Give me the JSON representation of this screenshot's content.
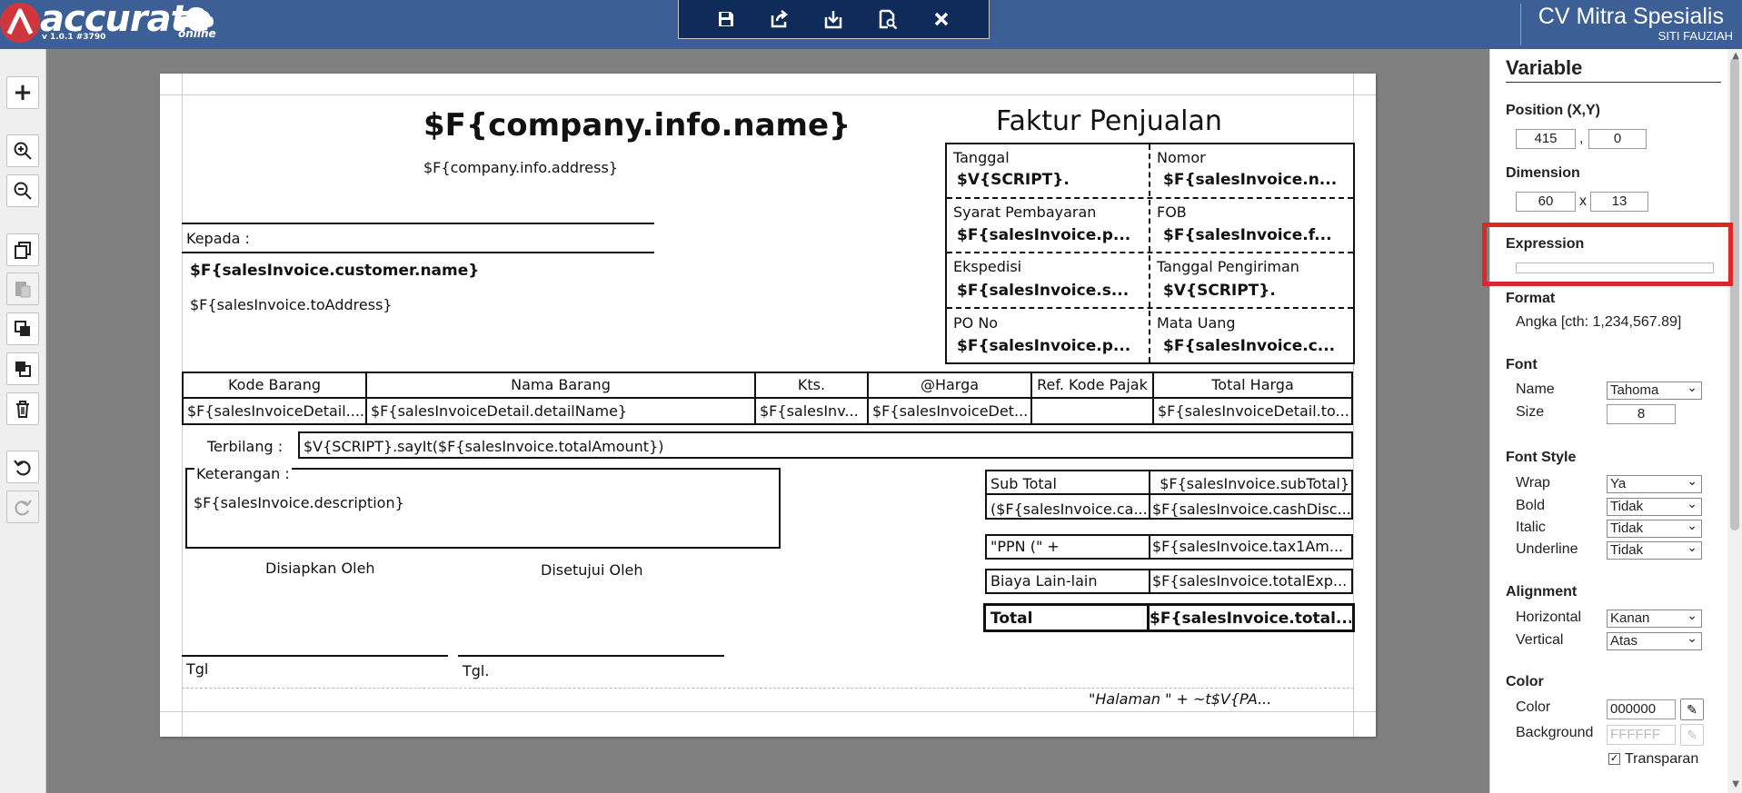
{
  "header": {
    "logo_text": "accurate",
    "logo_version": "v 1.0.1 #3790",
    "logo_online": "online",
    "company": "CV Mitra Spesialis",
    "user": "SITI FAUZIAH",
    "toolbar": [
      {
        "icon": "save-icon",
        "glyph": "🖫"
      },
      {
        "icon": "export-icon",
        "glyph": "⇪"
      },
      {
        "icon": "import-icon",
        "glyph": "⇩"
      },
      {
        "icon": "preview-icon",
        "glyph": "🔍"
      },
      {
        "icon": "close-icon",
        "glyph": "✕"
      }
    ]
  },
  "tools": [
    {
      "name": "add-tool-button",
      "glyph": "+",
      "enabled": true
    },
    {
      "name": "zoom-in-button",
      "glyph": "⊕",
      "enabled": true
    },
    {
      "name": "zoom-out-button",
      "glyph": "⊖",
      "enabled": true
    },
    {
      "name": "copy-button",
      "glyph": "❐",
      "enabled": true
    },
    {
      "name": "paste-button",
      "glyph": "▤",
      "enabled": false
    },
    {
      "name": "bring-front-button",
      "glyph": "◘",
      "enabled": true
    },
    {
      "name": "send-back-button",
      "glyph": "◙",
      "enabled": true
    },
    {
      "name": "delete-button",
      "glyph": "🗑",
      "enabled": true
    },
    {
      "name": "undo-button",
      "glyph": "↺",
      "enabled": true
    },
    {
      "name": "redo-button",
      "glyph": "↻",
      "enabled": false
    }
  ],
  "doc": {
    "company_name": "$F{company.info.name}",
    "company_address": "$F{company.info.address}",
    "title": "Faktur Penjualan",
    "kepada_label": "Kepada :",
    "customer_name": "$F{salesInvoice.customer.name}",
    "to_address": "$F{salesInvoice.toAddress}",
    "info": [
      {
        "label": "Tanggal",
        "value": "$V{SCRIPT}."
      },
      {
        "label": "Nomor",
        "value": "$F{salesInvoice.n..."
      },
      {
        "label": "Syarat Pembayaran",
        "value": "$F{salesInvoice.p..."
      },
      {
        "label": "FOB",
        "value": "$F{salesInvoice.f..."
      },
      {
        "label": "Ekspedisi",
        "value": "$F{salesInvoice.s..."
      },
      {
        "label": "Tanggal Pengiriman",
        "value": "$V{SCRIPT}."
      },
      {
        "label": "PO No",
        "value": "$F{salesInvoice.p..."
      },
      {
        "label": "Mata Uang",
        "value": "$F{salesInvoice.c..."
      }
    ],
    "columns": [
      "Kode Barang",
      "Nama Barang",
      "Kts.",
      "@Harga",
      "Ref. Kode Pajak",
      "Total Harga"
    ],
    "row": [
      "$F{salesInvoiceDetail....",
      "$F{salesInvoiceDetail.detailName}",
      "$F{salesInv...",
      "$F{salesInvoiceDet...",
      "",
      "$F{salesInvoiceDetail.to..."
    ],
    "terbilang_label": "Terbilang :",
    "terbilang_value": "$V{SCRIPT}.sayIt($F{salesInvoice.totalAmount})",
    "keterangan_label": "Keterangan :",
    "description": "$F{salesInvoice.description}",
    "disiapkan": "Disiapkan Oleh",
    "disetujui": "Disetujui Oleh",
    "tgl1": "Tgl",
    "tgl2": "Tgl.",
    "totals": [
      {
        "label": "Sub Total",
        "value": "$F{salesInvoice.subTotal}"
      },
      {
        "label": "($F{salesInvoice.ca...",
        "value": "$F{salesInvoice.cashDisc..."
      },
      {
        "label": "\"PPN (\" +",
        "value": "$F{salesInvoice.tax1Am..."
      },
      {
        "label": "Biaya Lain-lain",
        "value": "$F{salesInvoice.totalExp..."
      },
      {
        "label": "Total",
        "value": "$F{salesInvoice.total..."
      }
    ],
    "page_footer": "\"Halaman \" +  ~t$V{PA..."
  },
  "panel": {
    "title": "Variable",
    "position_label": "Position (X,Y)",
    "pos_x": "415",
    "pos_y": "0",
    "dimension_label": "Dimension",
    "dim_w": "60",
    "dim_h": "13",
    "expression_label": "Expression",
    "expression_value": "",
    "format_label": "Format",
    "format_value": "Angka [cth: 1,234,567.89]",
    "font_label": "Font",
    "font_name_label": "Name",
    "font_name": "Tahoma",
    "font_size_label": "Size",
    "font_size": "8",
    "font_style_label": "Font Style",
    "wrap_label": "Wrap",
    "wrap": "Ya",
    "bold_label": "Bold",
    "bold": "Tidak",
    "italic_label": "Italic",
    "italic": "Tidak",
    "underline_label": "Underline",
    "underline": "Tidak",
    "alignment_label": "Alignment",
    "horizontal_label": "Horizontal",
    "horizontal": "Kanan",
    "vertical_label": "Vertical",
    "vertical": "Atas",
    "color_label": "Color",
    "color_field_label": "Color",
    "color_value": "000000",
    "background_label": "Background",
    "background_value": "FFFFFF",
    "transparan_label": "Transparan"
  },
  "colors": {
    "header": "#3c5f96",
    "toolbar": "#0e2b5a",
    "highlight": "#d9292c",
    "logo": "#d0373c"
  }
}
